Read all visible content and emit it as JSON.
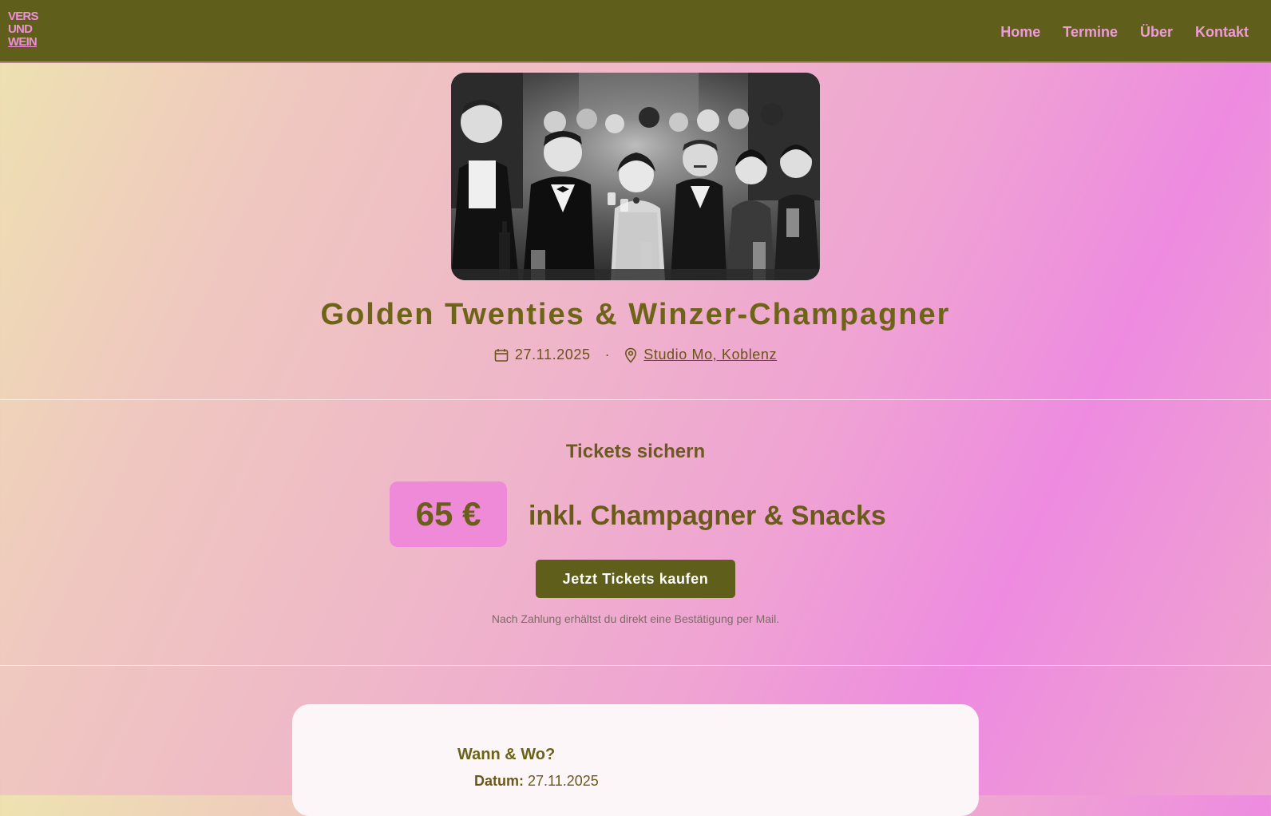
{
  "header": {
    "logo_lines": [
      "VERS",
      "UND",
      "WEIN"
    ],
    "nav": [
      {
        "label": "Home"
      },
      {
        "label": "Termine"
      },
      {
        "label": "Über"
      },
      {
        "label": "Kontakt"
      }
    ]
  },
  "hero": {
    "title": "Golden Twenties & Winzer-Champagner",
    "date": "27.11.2025",
    "separator": "·",
    "location": "Studio Mo, Koblenz"
  },
  "tickets": {
    "heading": "Tickets sichern",
    "price": "65 €",
    "price_note": "inkl. Champagner & Snacks",
    "button_label": "Jetzt Tickets kaufen",
    "confirmation": "Nach Zahlung erhältst du direkt eine Bestätigung per Mail."
  },
  "info": {
    "heading": "Wann & Wo?",
    "date_label": "Datum:",
    "date_value": "27.11.2025"
  },
  "colors": {
    "header_bg": "#5f5e1a",
    "accent_pink": "#ef8ad9",
    "text_olive": "#6e6418",
    "button_bg": "#5f5e1a",
    "card_bg": "#fcf6f8"
  },
  "icons": {
    "date": "calendar-icon",
    "location": "map-pin-icon"
  }
}
